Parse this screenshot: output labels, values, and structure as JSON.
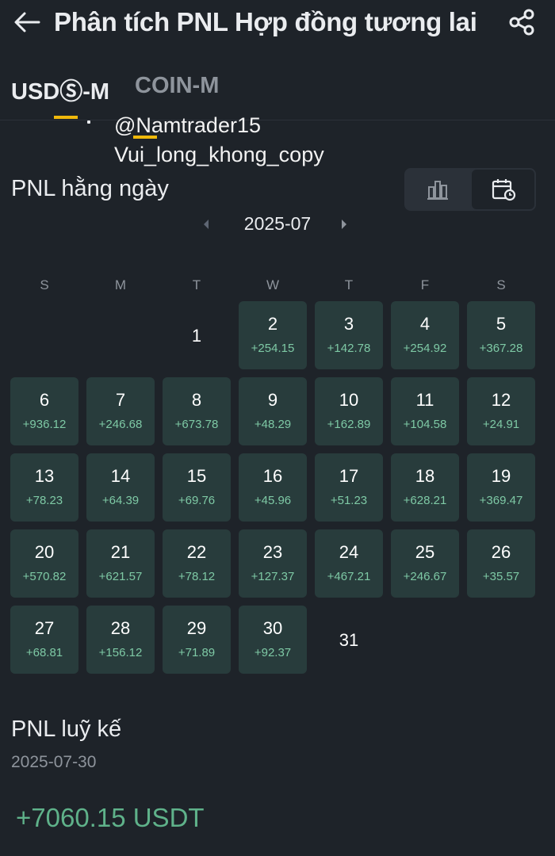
{
  "header": {
    "title": "Phân tích PNL Hợp đồng tương lai",
    "back_icon": "arrow-left-icon",
    "share_icon": "share-icon"
  },
  "tabs": [
    {
      "label": "USDⓈ-M",
      "active": true
    },
    {
      "label": "COIN-M",
      "active": false
    }
  ],
  "watermark": {
    "line1": "@Namtrader15",
    "line2": "Vui_long_khong_copy"
  },
  "daily": {
    "title": "PNL hằng ngày",
    "view_icons": [
      "bar-chart-icon",
      "calendar-clock-icon"
    ],
    "month": "2025-07",
    "weekdays": [
      "S",
      "M",
      "T",
      "W",
      "T",
      "F",
      "S"
    ],
    "days": [
      {
        "day": "1",
        "pnl": ""
      },
      {
        "day": "2",
        "pnl": "+254.15"
      },
      {
        "day": "3",
        "pnl": "+142.78"
      },
      {
        "day": "4",
        "pnl": "+254.92"
      },
      {
        "day": "5",
        "pnl": "+367.28"
      },
      {
        "day": "6",
        "pnl": "+936.12"
      },
      {
        "day": "7",
        "pnl": "+246.68"
      },
      {
        "day": "8",
        "pnl": "+673.78"
      },
      {
        "day": "9",
        "pnl": "+48.29"
      },
      {
        "day": "10",
        "pnl": "+162.89"
      },
      {
        "day": "11",
        "pnl": "+104.58"
      },
      {
        "day": "12",
        "pnl": "+24.91"
      },
      {
        "day": "13",
        "pnl": "+78.23"
      },
      {
        "day": "14",
        "pnl": "+64.39"
      },
      {
        "day": "15",
        "pnl": "+69.76"
      },
      {
        "day": "16",
        "pnl": "+45.96"
      },
      {
        "day": "17",
        "pnl": "+51.23"
      },
      {
        "day": "18",
        "pnl": "+628.21"
      },
      {
        "day": "19",
        "pnl": "+369.47"
      },
      {
        "day": "20",
        "pnl": "+570.82"
      },
      {
        "day": "21",
        "pnl": "+621.57"
      },
      {
        "day": "22",
        "pnl": "+78.12"
      },
      {
        "day": "23",
        "pnl": "+127.37"
      },
      {
        "day": "24",
        "pnl": "+467.21"
      },
      {
        "day": "25",
        "pnl": "+246.67"
      },
      {
        "day": "26",
        "pnl": "+35.57"
      },
      {
        "day": "27",
        "pnl": "+68.81"
      },
      {
        "day": "28",
        "pnl": "+156.12"
      },
      {
        "day": "29",
        "pnl": "+71.89"
      },
      {
        "day": "30",
        "pnl": "+92.37"
      },
      {
        "day": "31",
        "pnl": ""
      }
    ]
  },
  "cumulative": {
    "title": "PNL luỹ kế",
    "date": "2025-07-30",
    "value": "+7060.15 USDT"
  },
  "colors": {
    "background": "#1e2329",
    "cell_background": "#283c3c",
    "positive": "#7ec9a5",
    "cumulative_positive": "#5fb28a",
    "watermark_accent": "#f0b90b"
  }
}
